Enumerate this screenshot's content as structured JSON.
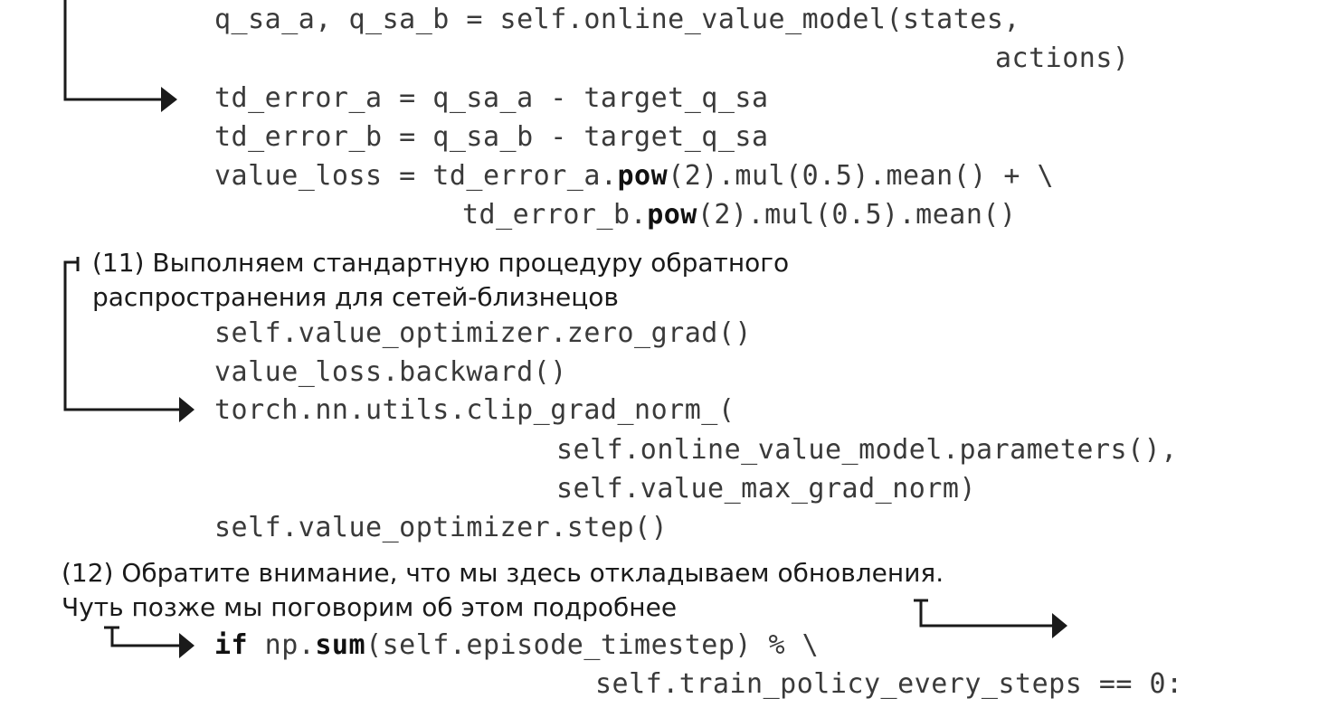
{
  "code_block_1": {
    "line1": "q_sa_a, q_sa_b = self.online_value_model(states,",
    "line2": "actions)",
    "line3": "td_error_a = q_sa_a - target_q_sa",
    "line4": "td_error_b = q_sa_b - target_q_sa",
    "line5_pre": "value_loss = td_error_a.",
    "line5_bold": "pow",
    "line5_post": "(2).mul(0.5).mean() + \\",
    "line6_pre": "td_error_b.",
    "line6_bold": "pow",
    "line6_post": "(2).mul(0.5).mean()"
  },
  "note_11": {
    "line1": "(11) Выполняем стандартную процедуру обратного",
    "line2": "распространения для сетей-близнецов"
  },
  "code_block_2": {
    "line1": "self.value_optimizer.zero_grad()",
    "line2": "value_loss.backward()",
    "line3": "torch.nn.utils.clip_grad_norm_(",
    "line4": "self.online_value_model.parameters(),",
    "line5": "self.value_max_grad_norm)",
    "line6": "self.value_optimizer.step()"
  },
  "note_12": {
    "line1": "(12) Обратите внимание, что мы здесь откладываем обновления.",
    "line2": "Чуть позже мы поговорим об этом подробнее"
  },
  "code_block_3": {
    "line1_kw": "if",
    "line1_pre": " np.",
    "line1_bold": "sum",
    "line1_post": "(self.episode_timestep) % \\",
    "line2": "self.train_policy_every_steps == 0:"
  }
}
